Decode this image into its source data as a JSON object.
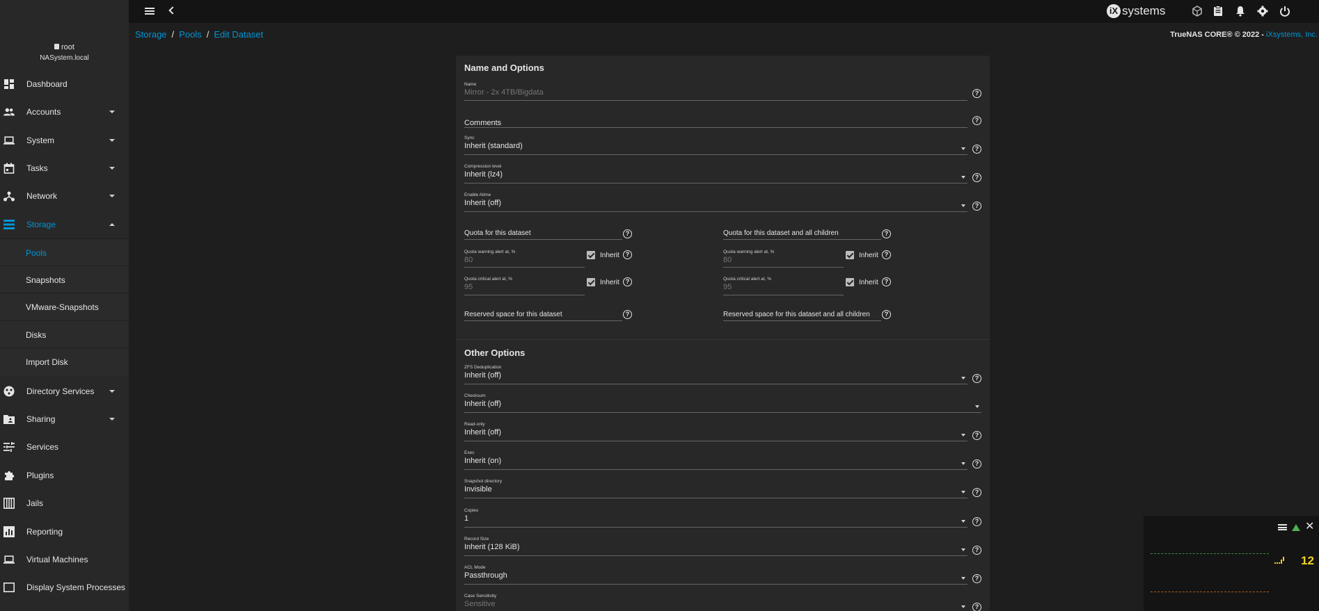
{
  "user": {
    "name": "root",
    "host": "NASystem.local"
  },
  "nav": {
    "items": [
      {
        "label": "Dashboard",
        "icon": "dashboard-icon",
        "expandable": false
      },
      {
        "label": "Accounts",
        "icon": "accounts-icon",
        "expandable": true
      },
      {
        "label": "System",
        "icon": "laptop-icon",
        "expandable": true
      },
      {
        "label": "Tasks",
        "icon": "calendar-icon",
        "expandable": true
      },
      {
        "label": "Network",
        "icon": "network-icon",
        "expandable": true
      },
      {
        "label": "Storage",
        "icon": "storage-icon",
        "expandable": true
      }
    ],
    "storage_sub": [
      "Pools",
      "Snapshots",
      "VMware-Snapshots",
      "Disks",
      "Import Disk"
    ],
    "items_after": [
      {
        "label": "Directory Services",
        "icon": "directory-icon",
        "expandable": true
      },
      {
        "label": "Sharing",
        "icon": "folder-share-icon",
        "expandable": true
      },
      {
        "label": "Services",
        "icon": "tune-icon",
        "expandable": false
      },
      {
        "label": "Plugins",
        "icon": "puzzle-icon",
        "expandable": false
      },
      {
        "label": "Jails",
        "icon": "jail-icon",
        "expandable": false
      },
      {
        "label": "Reporting",
        "icon": "chart-icon",
        "expandable": false
      },
      {
        "label": "Virtual Machines",
        "icon": "monitor-icon",
        "expandable": false
      },
      {
        "label": "Display System Processes",
        "icon": "terminal-icon",
        "expandable": false
      }
    ]
  },
  "topbar": {
    "brand": "systems",
    "brand_mark": "iX"
  },
  "breadcrumb": [
    "Storage",
    "Pools",
    "Edit Dataset"
  ],
  "copyright": {
    "text": "TrueNAS CORE® © 2022 - ",
    "link": "iXsystems, Inc."
  },
  "form": {
    "section1": "Name and Options",
    "name": {
      "label": "Name",
      "value": "Mirror - 2x 4TB/Bigdata"
    },
    "comments": {
      "label": "Comments"
    },
    "sync": {
      "label": "Sync",
      "value": "Inherit (standard)"
    },
    "compression": {
      "label": "Compression level",
      "value": "Inherit (lz4)"
    },
    "atime": {
      "label": "Enable Atime",
      "value": "Inherit (off)"
    },
    "quota": {
      "left_title": "Quota for this dataset",
      "right_title": "Quota for this dataset and all children",
      "warn_label": "Quota warning alert at, %",
      "warn_value": "80",
      "crit_label": "Quota critical alert at, %",
      "crit_value": "95",
      "inherit": "Inherit"
    },
    "reserved_left": "Reserved space for this dataset",
    "reserved_right": "Reserved space for this dataset and all children",
    "section2": "Other Options",
    "dedup": {
      "label": "ZFS Deduplication",
      "value": "Inherit (off)"
    },
    "checksum": {
      "label": "Checksum",
      "value": "Inherit (off)"
    },
    "readonly": {
      "label": "Read-only",
      "value": "Inherit (off)"
    },
    "exec": {
      "label": "Exec",
      "value": "Inherit (on)"
    },
    "snapdir": {
      "label": "Snapshot directory",
      "value": "Invisible"
    },
    "copies": {
      "label": "Copies",
      "value": "1"
    },
    "recordsize": {
      "label": "Record Size",
      "value": "Inherit (128 KiB)"
    },
    "aclmode": {
      "label": "ACL Mode",
      "value": "Passthrough"
    },
    "casesens": {
      "label": "Case Sensitivity",
      "value": "Sensitive"
    }
  },
  "widget": {
    "value": "12"
  }
}
